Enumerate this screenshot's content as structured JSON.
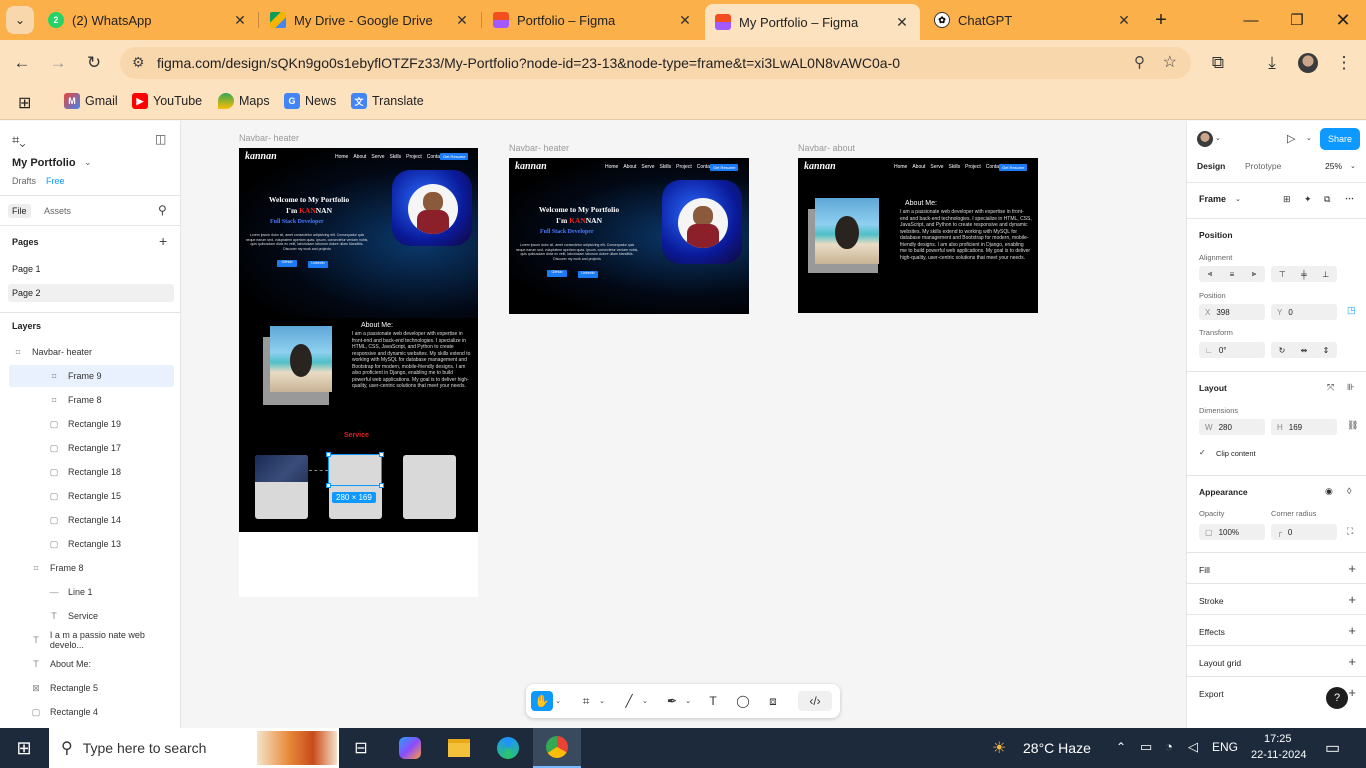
{
  "tabs": [
    {
      "label": "(2) WhatsApp",
      "icon": "whatsapp-icon",
      "badge": "2"
    },
    {
      "label": "My Drive - Google Drive",
      "icon": "google-drive-icon"
    },
    {
      "label": "Portfolio – Figma",
      "icon": "figma-icon"
    },
    {
      "label": "My Portfolio – Figma",
      "icon": "figma-icon",
      "active": true
    },
    {
      "label": "ChatGPT",
      "icon": "chatgpt-icon"
    }
  ],
  "address_bar": {
    "url": "figma.com/design/sQKn9go0s1ebyflOTZFz33/My-Portfolio?node-id=23-13&node-type=frame&t=xi3LwAL0N8vAWC0a-0"
  },
  "bookmarks": [
    "Gmail",
    "YouTube",
    "Maps",
    "News",
    "Translate"
  ],
  "left_panel": {
    "file_name": "My Portfolio",
    "drafts": "Drafts",
    "plan": "Free",
    "tabs": [
      "File",
      "Assets"
    ],
    "pages_title": "Pages",
    "pages": [
      "Page 1",
      "Page 2"
    ],
    "layers_title": "Layers",
    "layers": [
      {
        "name": "Navbar- heater",
        "icon": "frame-icon",
        "indent": 0
      },
      {
        "name": "Frame 9",
        "icon": "frame-icon",
        "indent": 2,
        "selected": true
      },
      {
        "name": "Frame 8",
        "icon": "frame-icon",
        "indent": 2
      },
      {
        "name": "Rectangle 19",
        "icon": "rectangle-icon",
        "indent": 2
      },
      {
        "name": "Rectangle 17",
        "icon": "rectangle-icon",
        "indent": 2
      },
      {
        "name": "Rectangle 18",
        "icon": "rectangle-icon",
        "indent": 2
      },
      {
        "name": "Rectangle 15",
        "icon": "rectangle-icon",
        "indent": 2
      },
      {
        "name": "Rectangle 14",
        "icon": "rectangle-icon",
        "indent": 2
      },
      {
        "name": "Rectangle 13",
        "icon": "rectangle-icon",
        "indent": 2
      },
      {
        "name": "Frame 8",
        "icon": "frame-icon",
        "indent": 1
      },
      {
        "name": "Line 1",
        "icon": "line-icon",
        "indent": 2
      },
      {
        "name": "Service",
        "icon": "text-icon",
        "indent": 2
      },
      {
        "name": "I a m a passio nate web develo...",
        "icon": "text-icon",
        "indent": 1
      },
      {
        "name": "About Me:",
        "icon": "text-icon",
        "indent": 1
      },
      {
        "name": "Rectangle 5",
        "icon": "image-icon",
        "indent": 1
      },
      {
        "name": "Rectangle 4",
        "icon": "rectangle-icon",
        "indent": 1
      }
    ]
  },
  "canvas": {
    "frames": [
      {
        "label": "Navbar- heater"
      },
      {
        "label": "Navbar- heater"
      },
      {
        "label": "Navbar- about"
      }
    ],
    "logo": "kannan",
    "menu": [
      "Home",
      "About",
      "Serve",
      "Skills",
      "Project",
      "Contact"
    ],
    "hire_button": "Get Resume",
    "hero_title_1": "Welcome to My Portfolio",
    "hero_title_2a": "I'm ",
    "hero_title_2b": "KAN",
    "hero_title_2c": "NAN",
    "hero_subtitle": "Full Stack Developer",
    "hero_text": "Lorem ipsum dolor sit, amet consectetur adipisicing elit. Consequatur quis neque earum sed, voluptatem aperiam quas. Ipsum, consectetur veniam nobis, quis quibusdam dicta ex velit, laboriosam laborum dolore ullam blanditiis. Discover my work and projects",
    "btn_github": "GitHub",
    "btn_linkedin": "LinkedIn",
    "about_heading": "About Me:",
    "about_text": "I am a passionate web developer with expertise in front-end and back-end technologies. I specialize in HTML, CSS, JavaScript, and Python to create responsive and dynamic websites. My skills extend to working with MySQL for database management and Bootstrap for modern, mobile-friendly designs. I am also proficient in Django, enabling me to build powerful web applications. My goal is to deliver high-quality, user-centric solutions that meet your needs.",
    "service_heading": "Service",
    "selection_size": "280 × 169"
  },
  "tools": [
    "hand-icon",
    "frame-tool-icon",
    "line-tool-icon",
    "pen-tool-icon",
    "text-tool-icon",
    "comment-icon",
    "components-icon",
    "dev-mode-icon"
  ],
  "right_panel": {
    "share": "Share",
    "mode_tabs": [
      "Design",
      "Prototype"
    ],
    "zoom": "25%",
    "layer_type": "Frame",
    "position_title": "Position",
    "alignment_label": "Alignment",
    "position_label": "Position",
    "x_label": "X",
    "x_value": "398",
    "y_label": "Y",
    "y_value": "0",
    "transform_label": "Transform",
    "rotation": "0°",
    "layout_title": "Layout",
    "dimensions_label": "Dimensions",
    "w_label": "W",
    "w_value": "280",
    "h_label": "H",
    "h_value": "169",
    "clip_content": "Clip content",
    "appearance_title": "Appearance",
    "opacity_label": "Opacity",
    "opacity_value": "100%",
    "corner_label": "Corner radius",
    "corner_value": "0",
    "sections": [
      "Fill",
      "Stroke",
      "Effects",
      "Layout grid",
      "Export"
    ],
    "help": "?"
  },
  "taskbar": {
    "search_placeholder": "Type here to search",
    "weather": "28°C  Haze",
    "lang": "ENG",
    "time": "17:25",
    "date": "22-11-2024"
  },
  "colors": {
    "chrome_accent": "#fbb04a",
    "chrome_toolbar": "#fde2c0",
    "figma_blue": "#0d99ff",
    "service_red": "#e62020"
  }
}
